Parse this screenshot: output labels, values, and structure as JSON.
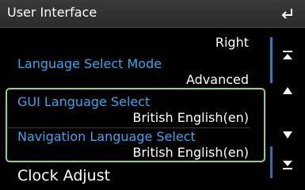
{
  "header": {
    "title": "User Interface",
    "back_icon": "back-arrow-icon"
  },
  "items": [
    {
      "label": "",
      "value": "Right"
    },
    {
      "label": "Language Select Mode",
      "value": "Advanced"
    },
    {
      "label": "GUI Language Select",
      "value": "British English(en)"
    },
    {
      "label": "Navigation Language Select",
      "value": "British English(en)"
    },
    {
      "label": "Clock Adjust",
      "value": ""
    }
  ],
  "scroll": {
    "top_icon": "scroll-to-top-icon",
    "up_icon": "scroll-up-icon",
    "down_icon": "scroll-down-icon",
    "bottom_icon": "scroll-to-bottom-icon"
  },
  "colors": {
    "label_blue": "#3aa6f0",
    "highlight_green": "#8fd27f",
    "header_gray": "#333333"
  }
}
